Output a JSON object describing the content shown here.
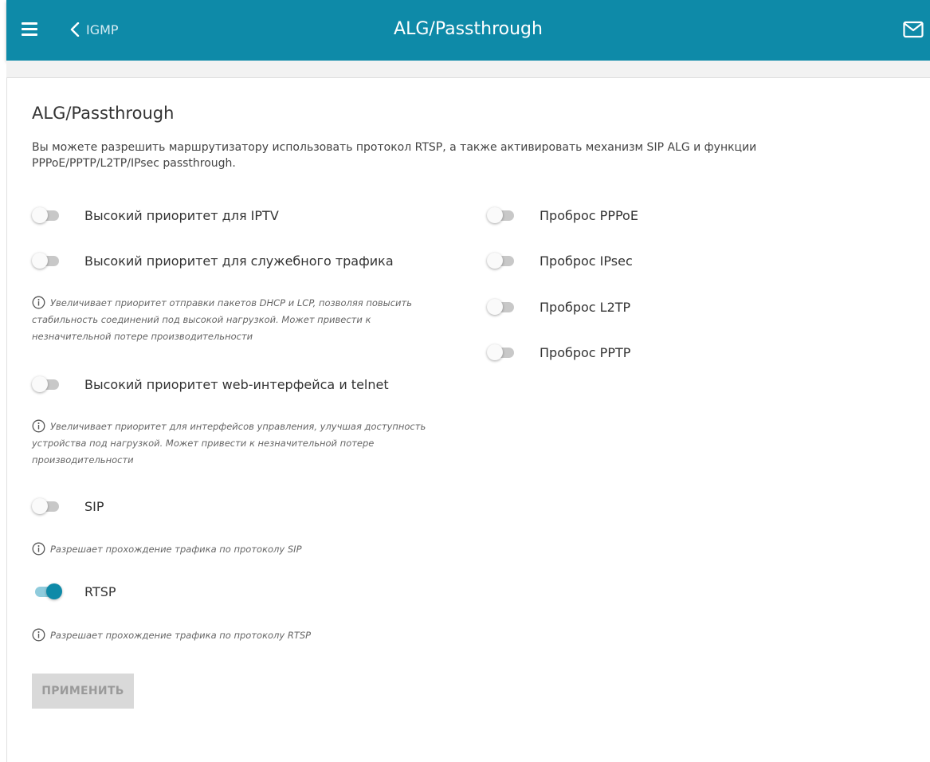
{
  "header": {
    "back_label": "IGMP",
    "title": "ALG/Passthrough",
    "bar_color": "#0e8aa8"
  },
  "section": {
    "title": "ALG/Passthrough",
    "description": "Вы можете разрешить маршрутизатору использовать протокол RTSP, а также активировать механизм SIP ALG и функции PPPoE/PPTP/L2TP/IPsec passthrough."
  },
  "left_toggles": [
    {
      "label": "Высокий приоритет для IPTV",
      "enabled": false
    },
    {
      "label": "Высокий приоритет для служебного трафика",
      "enabled": false,
      "hint": "Увеличивает приоритет отправки пакетов DHCP и LCP, позволяя повысить стабильность соединений под высокой нагрузкой. Может привести к незначительной потере производительности"
    },
    {
      "label": "Высокий приоритет web-интерфейса и telnet",
      "enabled": false,
      "hint": "Увеличивает приоритет для интерфейсов управления, улучшая доступность устройства под нагрузкой. Может привести к незначительной потере производительности"
    },
    {
      "label": "SIP",
      "enabled": false,
      "hint": "Разрешает прохождение трафика по протоколу SIP"
    },
    {
      "label": "RTSP",
      "enabled": true,
      "hint": "Разрешает прохождение трафика по протоколу RTSP"
    }
  ],
  "right_toggles": [
    {
      "label": "Проброс PPPoE",
      "enabled": false
    },
    {
      "label": "Проброс IPsec",
      "enabled": false
    },
    {
      "label": "Проброс L2TP",
      "enabled": false
    },
    {
      "label": "Проброс PPTP",
      "enabled": false
    }
  ],
  "apply_button": {
    "label": "ПРИМЕНИТЬ",
    "disabled": true
  },
  "icons": {
    "menu": "hamburger-menu-icon",
    "back": "chevron-left-icon",
    "mail": "envelope-icon",
    "info": "info-circle-icon"
  }
}
